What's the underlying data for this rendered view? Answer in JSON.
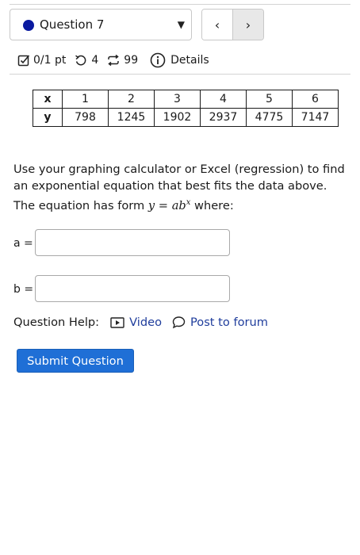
{
  "question_selector": {
    "label": "Question 7",
    "status_color": "#0a1aa0",
    "status_icon": "filled-circle",
    "caret_icon": "caret-down",
    "caret_glyph": "▼"
  },
  "nav": {
    "prev_glyph": "‹",
    "next_glyph": "›",
    "prev_icon": "chevron-left",
    "next_icon": "chevron-right"
  },
  "meta": {
    "score": "0/1 pt",
    "score_icon": "checkbox-icon",
    "retries": "4",
    "retries_icon": "retry-icon",
    "attempts": "99",
    "attempts_icon": "repeat-icon",
    "details_label": "Details",
    "details_icon": "info-icon"
  },
  "table": {
    "row_headers": [
      "x",
      "y"
    ],
    "x_values": [
      "1",
      "2",
      "3",
      "4",
      "5",
      "6"
    ],
    "y_values": [
      "798",
      "1245",
      "1902",
      "2937",
      "4775",
      "7147"
    ]
  },
  "prompt": {
    "text": "Use your graphing calculator or Excel (regression) to find an exponential equation that best fits the data above. The equation has form",
    "formula_y": "y",
    "formula_eq": " = ",
    "formula_ab": "ab",
    "formula_exp": "x",
    "suffix": " where:"
  },
  "fields": {
    "a_label": "a =",
    "a_value": "",
    "b_label": "b =",
    "b_value": ""
  },
  "help": {
    "label": "Question Help:",
    "video_label": "Video",
    "video_icon": "video-icon",
    "forum_label": "Post to forum",
    "forum_icon": "speech-bubble-icon"
  },
  "submit_label": "Submit Question",
  "colors": {
    "link": "#1f3d9c",
    "button": "#1f6fd6"
  }
}
